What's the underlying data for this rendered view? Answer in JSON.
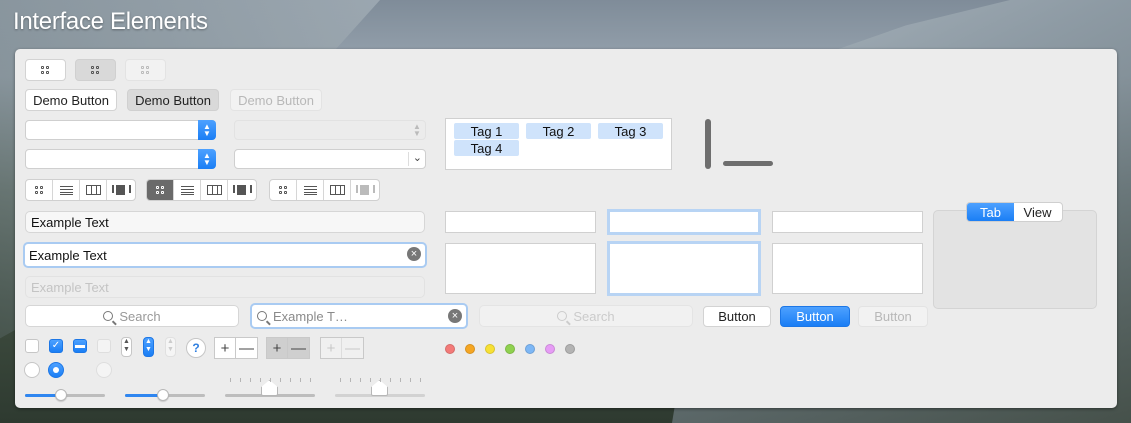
{
  "window": {
    "title": "Interface Elements"
  },
  "buttons": {
    "demo": [
      "Demo Button",
      "Demo Button",
      "Demo Button"
    ],
    "push": [
      "Button",
      "Button",
      "Button"
    ]
  },
  "tags": [
    "Tag 1",
    "Tag 2",
    "Tag 3",
    "Tag 4"
  ],
  "fields": {
    "text1": "Example Text",
    "text2": "Example Text",
    "text_disabled_placeholder": "Example Text"
  },
  "search": {
    "placeholder1": "Search",
    "focused_value": "Example T…",
    "placeholder_disabled": "Search"
  },
  "tabview": {
    "tabs": [
      "Tab",
      "View"
    ],
    "selected": 0
  },
  "help_label": "?",
  "plus": "+",
  "minus": "—",
  "colors": {
    "accent": "#1a7ef5",
    "label_dots": [
      "#f37a78",
      "#f5a623",
      "#f7e034",
      "#8fd14f",
      "#7db7f5",
      "#e69cf5",
      "#b3b3b3"
    ]
  },
  "sliders": [
    {
      "value": 0.45
    },
    {
      "value": 0.48
    },
    {
      "value": 0.5
    },
    {
      "value": 0.5
    }
  ],
  "icons": {
    "view_modes": [
      "icon-grid-icon",
      "list-icon",
      "columns-icon",
      "cover-flow-icon"
    ],
    "search": "magnifier-icon",
    "clear": "clear-icon"
  }
}
